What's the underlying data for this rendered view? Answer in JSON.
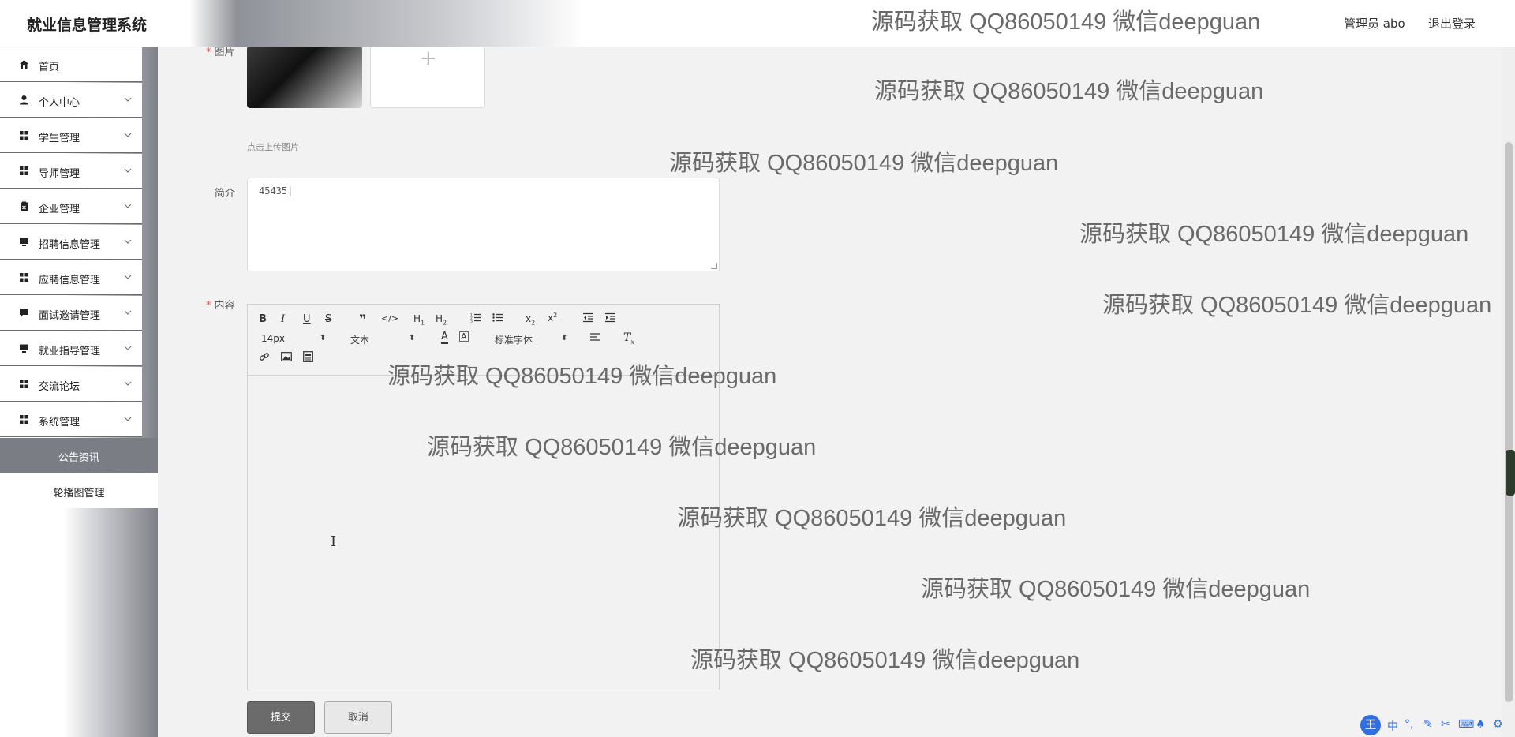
{
  "header": {
    "app_title": "就业信息管理系统",
    "user_label": "管理员 abo",
    "logout_label": "退出登录"
  },
  "sidebar": {
    "items": [
      {
        "label": "首页",
        "icon": "home-icon"
      },
      {
        "label": "个人中心",
        "icon": "person-icon"
      },
      {
        "label": "学生管理",
        "icon": "grid-icon"
      },
      {
        "label": "导师管理",
        "icon": "grid-icon"
      },
      {
        "label": "企业管理",
        "icon": "clipboard-icon"
      },
      {
        "label": "招聘信息管理",
        "icon": "monitor-icon"
      },
      {
        "label": "应聘信息管理",
        "icon": "grid-icon"
      },
      {
        "label": "面试邀请管理",
        "icon": "chat-icon"
      },
      {
        "label": "就业指导管理",
        "icon": "monitor-icon"
      },
      {
        "label": "交流论坛",
        "icon": "grid-icon"
      },
      {
        "label": "系统管理",
        "icon": "grid-icon"
      }
    ],
    "subitems": [
      {
        "label": "公告资讯",
        "active": true
      },
      {
        "label": "轮播图管理",
        "active": false
      }
    ]
  },
  "form": {
    "image_label": "图片",
    "upload_hint": "点击上传图片",
    "intro_label": "简介",
    "intro_value": "45435",
    "content_label": "内容"
  },
  "editor": {
    "font_size": "14px",
    "text_type": "文本",
    "font_family": "标准字体"
  },
  "buttons": {
    "submit": "提交",
    "cancel": "取消"
  },
  "watermark_text": "源码获取 QQ86050149 微信deepguan",
  "ime": {
    "logo": "王",
    "mode": "中"
  },
  "colors": {
    "accent": "#6b6b6b",
    "required": "#e05050",
    "ime": "#2f6fe0"
  }
}
